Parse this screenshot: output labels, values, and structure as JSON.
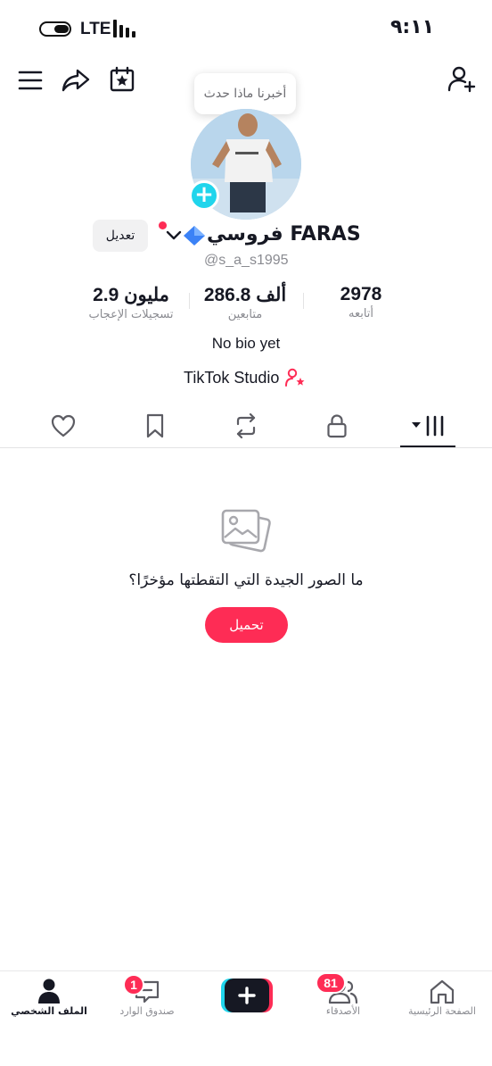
{
  "status_bar": {
    "time": "٩:١١",
    "network": "LTE"
  },
  "header": {
    "tooltip": "أخبرنا ماذا حدث",
    "menu_icon": "hamburger-icon",
    "share_icon": "share-arrow-icon",
    "calendar_icon": "calendar-star-icon",
    "add_friend_icon": "add-person-icon"
  },
  "profile": {
    "name": "فروسي FARAS",
    "handle": "@s_a_s1995",
    "edit_label": "تعديل",
    "stats": {
      "following": {
        "value": "2978",
        "label": "أتابعه"
      },
      "followers": {
        "value": "286.8 ألف",
        "label": "متابعين"
      },
      "likes": {
        "value": "2.9 مليون",
        "label": "تسجيلات الإعجاب"
      }
    },
    "bio": "No bio yet",
    "studio": "TikTok Studio"
  },
  "tabs": [
    "videos-grid",
    "private-lock",
    "reposts",
    "favorites-bookmark",
    "liked-heart"
  ],
  "empty_state": {
    "title": "ما الصور الجيدة التي التقطتها مؤخرًا؟",
    "button": "تحميل"
  },
  "bottom_nav": {
    "profile": "الملف الشخصي",
    "inbox": "صندوق الوارد",
    "inbox_badge": "1",
    "friends": "الأصدقاء",
    "friends_badge": "81",
    "home": "الصفحة الرئيسية"
  },
  "colors": {
    "accent": "#fe2c55",
    "cyan": "#20d5ec",
    "text": "#161823",
    "muted": "#8a8b91"
  }
}
